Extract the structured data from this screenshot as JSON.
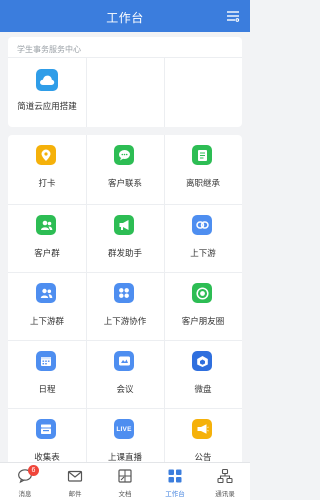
{
  "header": {
    "title": "工作台"
  },
  "section": {
    "title": "学生事务服务中心",
    "app": {
      "label": "简道云应用搭建",
      "icon": "cloud-icon",
      "color": "#2f9de8"
    }
  },
  "apps": [
    {
      "label": "打卡",
      "icon": "location-pin-icon",
      "color": "#f5b10a"
    },
    {
      "label": "客户联系",
      "icon": "chat-bubble-icon",
      "color": "#2dbd54"
    },
    {
      "label": "离职继承",
      "icon": "document-icon",
      "color": "#2dbd54"
    },
    {
      "label": "客户群",
      "icon": "group-icon",
      "color": "#2dbd54"
    },
    {
      "label": "群发助手",
      "icon": "megaphone-icon",
      "color": "#2dbd54"
    },
    {
      "label": "上下游",
      "icon": "link-icon",
      "color": "#4e8ef0"
    },
    {
      "label": "上下游群",
      "icon": "people-icon",
      "color": "#4e8ef0"
    },
    {
      "label": "上下游协作",
      "icon": "grid-apps-icon",
      "color": "#4e8ef0"
    },
    {
      "label": "客户朋友圈",
      "icon": "camera-shutter-icon",
      "color": "#2dbd54"
    },
    {
      "label": "日程",
      "icon": "calendar-icon",
      "color": "#4e8ef0"
    },
    {
      "label": "会议",
      "icon": "video-meeting-icon",
      "color": "#4e8ef0"
    },
    {
      "label": "微盘",
      "icon": "drive-icon",
      "color": "#2f6fde"
    },
    {
      "label": "收集表",
      "icon": "form-icon",
      "color": "#4e8ef0"
    },
    {
      "label": "上课直播",
      "icon": "live-icon",
      "color": "#4e8ef0",
      "icon_text": "LIVE"
    },
    {
      "label": "公告",
      "icon": "announcement-icon",
      "color": "#f5b10a"
    }
  ],
  "tabs": [
    {
      "label": "消息",
      "icon": "message-icon",
      "badge": "6"
    },
    {
      "label": "邮件",
      "icon": "mail-icon"
    },
    {
      "label": "文档",
      "icon": "document-tab-icon"
    },
    {
      "label": "工作台",
      "icon": "workbench-icon",
      "active": true
    },
    {
      "label": "通讯录",
      "icon": "contacts-icon"
    }
  ],
  "colors": {
    "primary": "#3b7ddd",
    "badge": "#f0453a"
  }
}
